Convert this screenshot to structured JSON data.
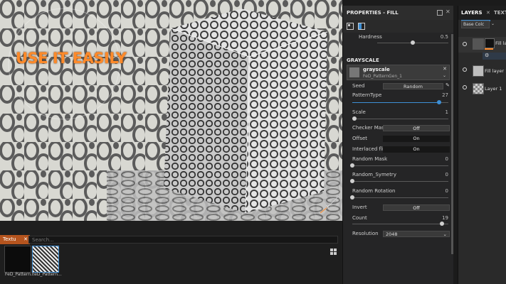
{
  "viewport": {
    "overlay_text": "USE IT EASILY",
    "axis_label": "X"
  },
  "shelf": {
    "tab_label": "Textu",
    "tab_close": "✕",
    "search_placeholder": "Search...",
    "thumbnails": [
      {
        "label": "FeD_Pattern..."
      },
      {
        "label": "FeD_Pattern..."
      }
    ]
  },
  "properties": {
    "title": "PROPERTIES - FILL",
    "hardness": {
      "label": "Hardness",
      "value": "0.5",
      "fraction": 0.5
    },
    "section_title": "GRAYSCALE",
    "resource": {
      "name": "grayscale",
      "subname": "FeD_PatternGen_1"
    },
    "seed": {
      "label": "Seed",
      "value": "Random"
    },
    "pattern_type": {
      "label": "PatternType",
      "value": "27",
      "fraction": 0.9
    },
    "scale": {
      "label": "Scale",
      "value": "1",
      "fraction": 0.02
    },
    "checker_mask": {
      "label": "Checker Mask",
      "value": "Off"
    },
    "offset": {
      "label": "Offset",
      "value": "On"
    },
    "interlaced_flip": {
      "label": "Interlaced flip",
      "value": "On"
    },
    "random_mask": {
      "label": "Random Mask",
      "value": "0",
      "fraction": 0.0
    },
    "random_symetry": {
      "label": "Random_Symetry",
      "value": "0",
      "fraction": 0.0
    },
    "random_rotation": {
      "label": "Random Rotation",
      "value": "0",
      "fraction": 0.0
    },
    "invert": {
      "label": "Invert",
      "value": "Off"
    },
    "count": {
      "label": "Count",
      "value": "19",
      "fraction": 0.93
    },
    "resolution": {
      "label": "Resolution",
      "value": "2048"
    }
  },
  "layers": {
    "tab_layers": "LAYERS",
    "tab_textures": "TEXTU",
    "channel_select": "Base Colc",
    "items": [
      {
        "name": "Fill lay"
      },
      {
        "name": "Fill layer 1"
      },
      {
        "name": "Layer 1"
      }
    ]
  },
  "colors": {
    "accent": "#3d8fd6",
    "overlay_text": "#ff8a2a",
    "tab_active": "#b5541e"
  }
}
